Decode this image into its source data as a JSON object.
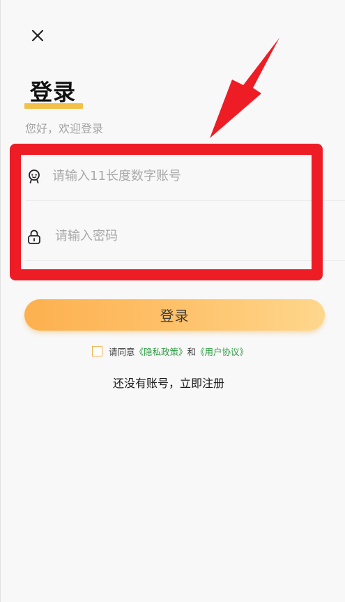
{
  "header": {
    "close_icon": "close-icon"
  },
  "title": "登录",
  "subtitle": "您好，欢迎登录",
  "form": {
    "account": {
      "icon": "user-icon",
      "value": "",
      "placeholder": "请输入11长度数字账号"
    },
    "password": {
      "icon": "lock-icon",
      "value": "",
      "placeholder": "请输入密码"
    }
  },
  "login_button": "登录",
  "agreement": {
    "checked": false,
    "prefix": "请同意",
    "privacy_link": "《隐私政策》",
    "conjunction": "和",
    "user_agreement_link": "《用户协议》"
  },
  "register_link": "还没有账号，立即注册",
  "colors": {
    "accent": "#f5b04a",
    "title_underline": "#f3c04a",
    "link": "#2a9d3f",
    "annotation": "#ee1c25"
  }
}
